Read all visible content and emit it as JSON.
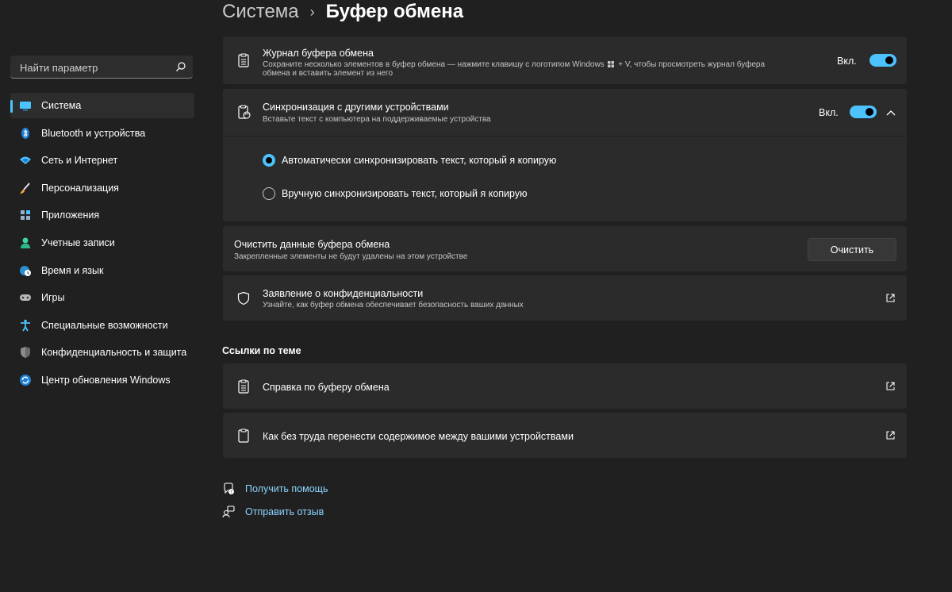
{
  "header": {
    "parent": "Система",
    "separator": "›",
    "current": "Буфер обмена"
  },
  "search": {
    "placeholder": "Найти параметр"
  },
  "sidebar": {
    "items": [
      {
        "label": "Система",
        "icon": "monitor-icon",
        "active": true
      },
      {
        "label": "Bluetooth и устройства",
        "icon": "bluetooth-icon"
      },
      {
        "label": "Сеть и Интернет",
        "icon": "wifi-icon"
      },
      {
        "label": "Персонализация",
        "icon": "brush-icon"
      },
      {
        "label": "Приложения",
        "icon": "apps-icon"
      },
      {
        "label": "Учетные записи",
        "icon": "person-icon"
      },
      {
        "label": "Время и язык",
        "icon": "globe-clock-icon"
      },
      {
        "label": "Игры",
        "icon": "gamepad-icon"
      },
      {
        "label": "Специальные возможности",
        "icon": "accessibility-icon"
      },
      {
        "label": "Конфиденциальность и защита",
        "icon": "shield-icon"
      },
      {
        "label": "Центр обновления Windows",
        "icon": "update-icon"
      }
    ]
  },
  "clipboard_history": {
    "title": "Журнал буфера обмена",
    "description_part1": "Сохраните несколько элементов в буфер обмена — нажмите клавишу с логотипом Windows",
    "description_part2": "+ V, чтобы просмотреть журнал буфера обмена и вставить элемент из него",
    "state_label": "Вкл.",
    "enabled": true
  },
  "sync": {
    "title": "Синхронизация с другими устройствами",
    "description": "Вставьте текст с компьютера на поддерживаемые устройства",
    "state_label": "Вкл.",
    "enabled": true,
    "options": [
      {
        "label": "Автоматически синхронизировать текст, который я копирую",
        "selected": true
      },
      {
        "label": "Вручную синхронизировать текст, который я копирую",
        "selected": false
      }
    ]
  },
  "clear": {
    "title": "Очистить данные буфера обмена",
    "description": "Закрепленные элементы не будут удалены на этом устройстве",
    "button_label": "Очистить"
  },
  "privacy": {
    "title": "Заявление о конфиденциальности",
    "description": "Узнайте, как буфер обмена обеспечивает безопасность ваших данных"
  },
  "related": {
    "section_title": "Ссылки по теме",
    "links": [
      {
        "label": "Справка по буферу обмена"
      },
      {
        "label": "Как без труда перенести содержимое между вашими устройствами"
      }
    ]
  },
  "footer": {
    "help": "Получить помощь",
    "feedback": "Отправить отзыв"
  },
  "colors": {
    "accent": "#4cc2ff",
    "background": "#202020",
    "card": "#2b2b2b",
    "link": "#8bd4ff"
  }
}
